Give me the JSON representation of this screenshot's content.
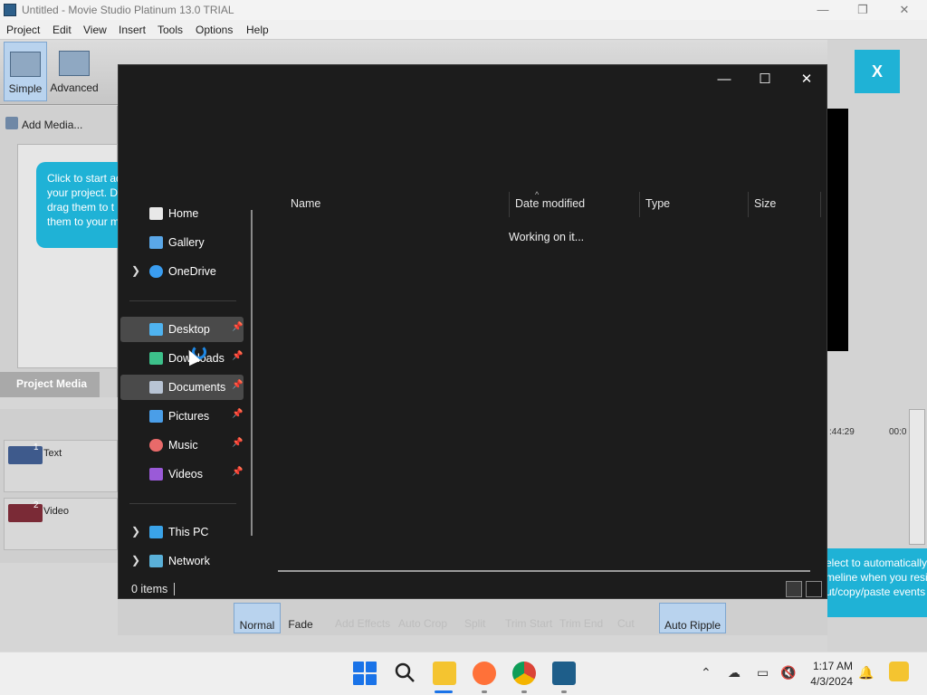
{
  "app": {
    "title": "Untitled - Movie Studio Platinum 13.0 TRIAL",
    "window_controls": [
      "—",
      "❐",
      "✕"
    ],
    "menu": [
      "Project",
      "Edit",
      "View",
      "Insert",
      "Tools",
      "Options",
      "Help"
    ],
    "modes": {
      "simple": "Simple",
      "advanced": "Advanced"
    },
    "add_media": "Add Media...",
    "help_bubble": [
      "Click to start ad",
      "your project. D",
      "drag them to t",
      "them to your m"
    ],
    "project_media_tab": "Project Media",
    "tracks": [
      {
        "num": "1",
        "name": "Text"
      },
      {
        "num": "2",
        "name": "Video"
      }
    ],
    "close_x": "X",
    "timecode_1": ":44:29",
    "timecode_2": "00:0",
    "tip_bubble": [
      "elect to automatically",
      "meline when you resi",
      "ut/copy/paste events"
    ],
    "bottom_buttons": {
      "normal": "Normal",
      "fade": "Fade",
      "auto_ripple": "Auto Ripple"
    },
    "bottom_faint": [
      "Add Effects",
      "Auto Crop",
      "Split",
      "Trim Start",
      "Trim End",
      "Cut"
    ]
  },
  "dialog": {
    "controls": {
      "minimize": "—",
      "maximize": "☐",
      "close": "✕"
    },
    "nav": [
      {
        "label": "Home",
        "icon": "home-icon",
        "pinned": false,
        "chevron": false,
        "selected": false
      },
      {
        "label": "Gallery",
        "icon": "gallery-icon",
        "pinned": false,
        "chevron": false,
        "selected": false
      },
      {
        "label": "OneDrive",
        "icon": "cloud-icon",
        "pinned": false,
        "chevron": true,
        "selected": false
      },
      {
        "label": "Desktop",
        "icon": "desktop-icon",
        "pinned": true,
        "chevron": false,
        "selected": true
      },
      {
        "label": "Downloads",
        "icon": "download-icon",
        "pinned": true,
        "chevron": false,
        "selected": false
      },
      {
        "label": "Documents",
        "icon": "document-icon",
        "pinned": true,
        "chevron": false,
        "selected": true
      },
      {
        "label": "Pictures",
        "icon": "pictures-icon",
        "pinned": true,
        "chevron": false,
        "selected": false
      },
      {
        "label": "Music",
        "icon": "music-icon",
        "pinned": true,
        "chevron": false,
        "selected": false
      },
      {
        "label": "Videos",
        "icon": "videos-icon",
        "pinned": true,
        "chevron": false,
        "selected": false
      },
      {
        "label": "This PC",
        "icon": "pc-icon",
        "pinned": false,
        "chevron": true,
        "selected": false
      },
      {
        "label": "Network",
        "icon": "network-icon",
        "pinned": false,
        "chevron": true,
        "selected": false
      }
    ],
    "columns": [
      "Name",
      "Date modified",
      "Type",
      "Size"
    ],
    "sort_indicator": "^",
    "status_message": "Working on it...",
    "item_count": "0 items"
  },
  "taskbar": {
    "time": "1:17 AM",
    "date": "4/3/2024"
  },
  "colors": {
    "dialog_bg": "#1c1c1c",
    "accent_cyan": "#1fb2d6",
    "selection": "#4a4a4a"
  }
}
